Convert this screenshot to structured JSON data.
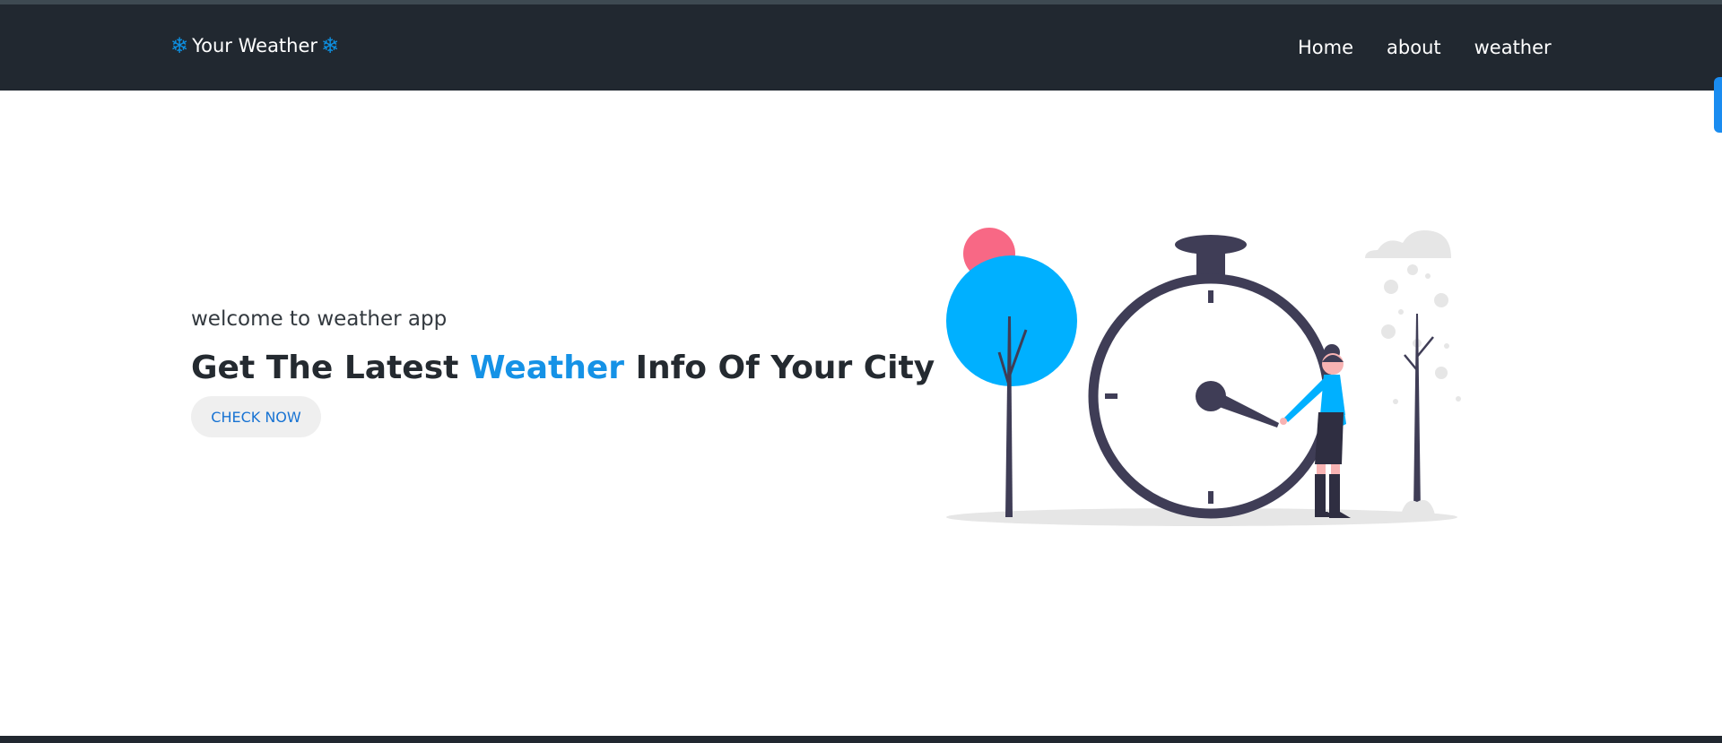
{
  "nav": {
    "brand": "Your Weather",
    "brand_icon": "snowflake-icon",
    "links": [
      "Home",
      "about",
      "weather"
    ]
  },
  "hero": {
    "subtitle": "welcome to weather app",
    "title_before": "Get The Latest ",
    "title_accent": "Weather",
    "title_after": " Info Of Your City",
    "cta_label": "CHECK NOW"
  },
  "colors": {
    "navbar_bg": "#212830",
    "accent": "#1592e6",
    "button_text": "#1873d3",
    "tree_blue": "#00b0ff",
    "sun_pink": "#f86885",
    "clock_dark": "#3f3d56"
  }
}
